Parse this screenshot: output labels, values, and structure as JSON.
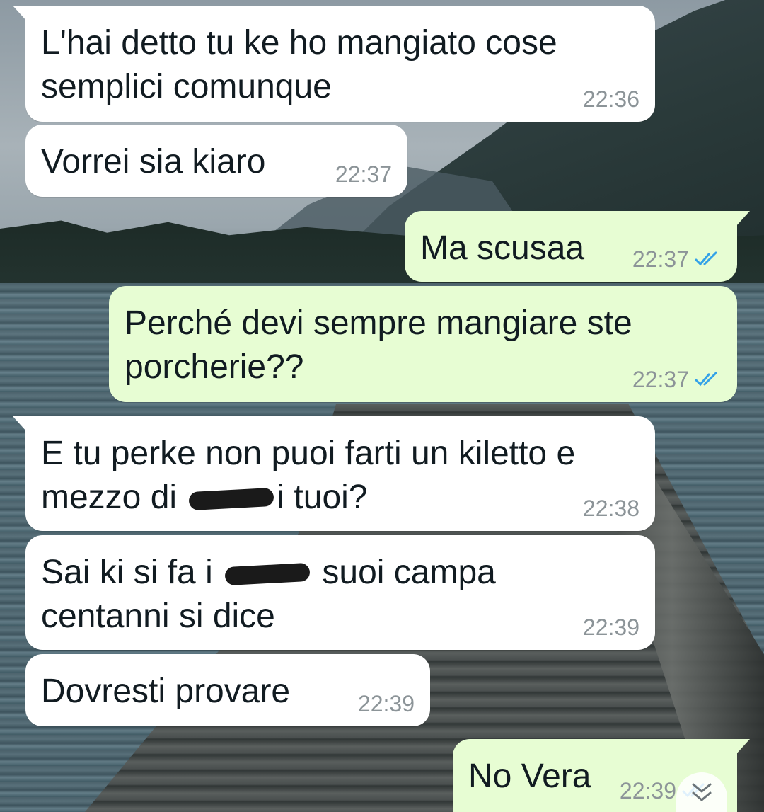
{
  "messages": [
    {
      "dir": "in",
      "tail": true,
      "text": "L'hai detto tu ke ho mangiato cose\nsemplici comunque",
      "time": "22:36"
    },
    {
      "dir": "in",
      "tail": false,
      "text": "Vorrei sia kiaro",
      "time": "22:37"
    },
    {
      "dir": "out",
      "tail": true,
      "text": "Ma scusaa",
      "time": "22:37",
      "status": "read"
    },
    {
      "dir": "out",
      "tail": false,
      "text": "Perché devi sempre mangiare ste\nporcherie??",
      "time": "22:37",
      "status": "read"
    },
    {
      "dir": "in",
      "tail": true,
      "text_before": "E tu perke non puoi farti un kiletto e\nmezzo di ",
      "text_after": "i tuoi?",
      "time": "22:38"
    },
    {
      "dir": "in",
      "tail": false,
      "text_before": "Sai ki si fa i ",
      "text_after": " suoi campa\ncentanni si dice",
      "time": "22:39"
    },
    {
      "dir": "in",
      "tail": false,
      "text": "Dovresti provare",
      "time": "22:39"
    },
    {
      "dir": "out",
      "tail": true,
      "text": "No Vera",
      "time": "22:39",
      "status": "read"
    }
  ],
  "colors": {
    "incoming_bubble": "#ffffff",
    "outgoing_bubble": "#e7fdd3",
    "timestamp": "#8c9498",
    "read_ticks": "#34a2e8"
  },
  "icons": {
    "read_receipt": "double-check-icon",
    "scroll_down": "chevron-double-down-icon"
  }
}
